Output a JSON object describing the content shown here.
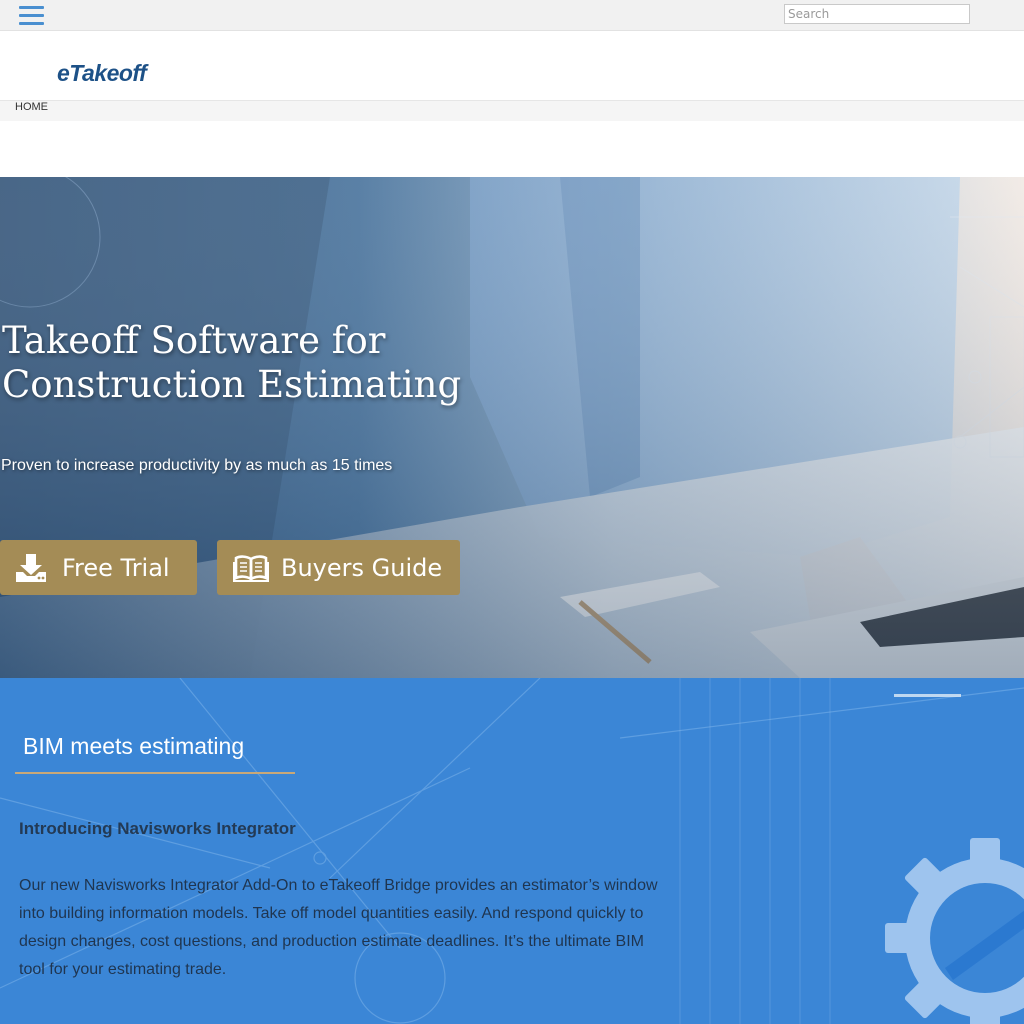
{
  "topbar": {
    "search_placeholder": "Search",
    "menu_icon": "hamburger-icon"
  },
  "header": {
    "logo_text": "eTakeoff"
  },
  "breadcrumb": {
    "home_label": "HOME"
  },
  "hero": {
    "title_line1": "Takeoff Software for",
    "title_line2": "Construction Estimating",
    "subtitle": "Proven to increase productivity by as much as 15 times",
    "buttons": [
      {
        "label": "Free Trial",
        "icon": "download-icon"
      },
      {
        "label": "Buyers Guide",
        "icon": "book-icon"
      }
    ]
  },
  "bim": {
    "heading": "BIM meets estimating",
    "subheading": "Introducing Navisworks Integrator",
    "body": "Our new Navisworks Integrator Add-On to eTakeoff Bridge provides an estimator’s window into building information models. Take off model quantities easily. And respond quickly to design changes, cost questions, and production estimate deadlines. It’s the ultimate BIM tool for your estimating trade.",
    "decoration_icon": "gear-icon"
  },
  "colors": {
    "accent_gold": "#a48c56",
    "logo_blue": "#1d5187",
    "section_blue": "#3b86d6",
    "menu_blue": "#4a8fd0"
  }
}
